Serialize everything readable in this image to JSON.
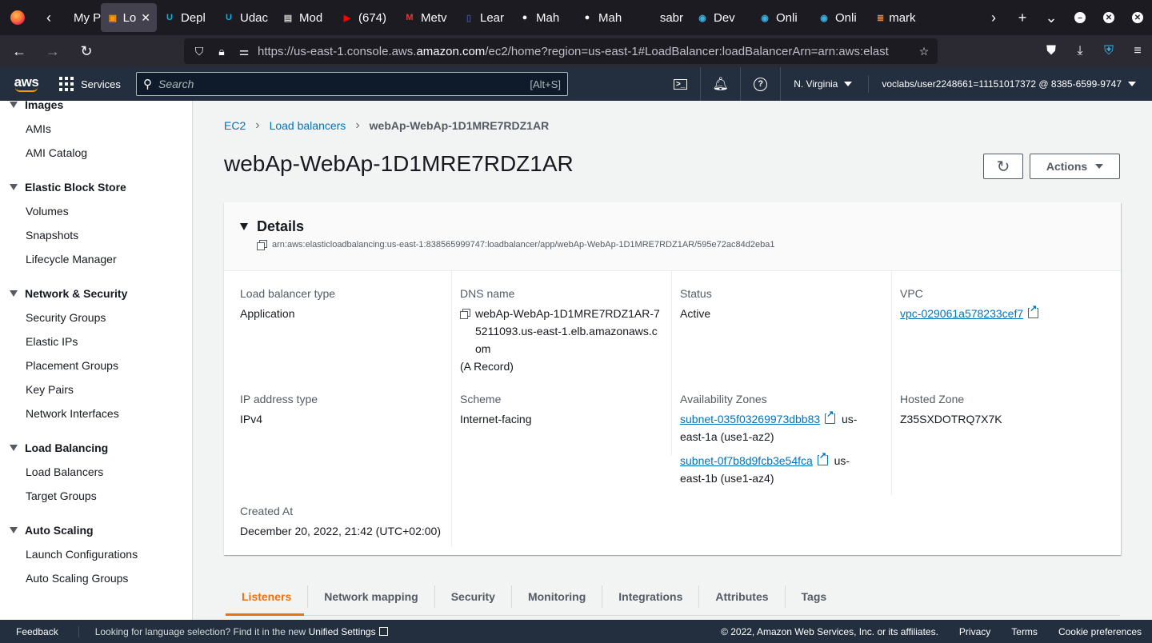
{
  "browser": {
    "tabs": [
      {
        "label": "My P",
        "icon": "page-icon",
        "color": "#fbfbfe"
      },
      {
        "label": "Lo",
        "icon": "aws-box-icon",
        "color": "#ff9900",
        "active": true
      },
      {
        "label": "Depl",
        "icon": "udacity-icon",
        "color": "#02b3e4"
      },
      {
        "label": "Udac",
        "icon": "udacity-icon",
        "color": "#02b3e4"
      },
      {
        "label": "Mod",
        "icon": "doc-icon",
        "color": "#cccccc"
      },
      {
        "label": "(674)",
        "icon": "youtube-icon",
        "color": "#ff0000"
      },
      {
        "label": "Metv",
        "icon": "m-icon",
        "color": "#e03a3a"
      },
      {
        "label": "Lear",
        "icon": "book-icon",
        "color": "#3d4f9f"
      },
      {
        "label": "Mah",
        "icon": "github-icon",
        "color": "#ffffff"
      },
      {
        "label": "Mah",
        "icon": "github-icon",
        "color": "#ffffff"
      },
      {
        "label": "sabr",
        "icon": "blank-icon",
        "color": "#888888"
      },
      {
        "label": "Dev",
        "icon": "eye-icon",
        "color": "#3ab0e0"
      },
      {
        "label": "Onli",
        "icon": "eye-icon",
        "color": "#3ab0e0"
      },
      {
        "label": "Onli",
        "icon": "eye-icon",
        "color": "#3ab0e0"
      },
      {
        "label": "mark",
        "icon": "stack-icon",
        "color": "#f48024"
      }
    ],
    "url_prefix": "https://us-east-1.console.aws.",
    "url_domain": "amazon.com",
    "url_rest": "/ec2/home?region=us-east-1#LoadBalancer:loadBalancerArn=arn:aws:elast"
  },
  "aws_header": {
    "logo": "aws",
    "services": "Services",
    "search_placeholder": "Search",
    "search_shortcut": "[Alt+S]",
    "region": "N. Virginia",
    "account": "voclabs/user2248661=11151017372 @ 8385-6599-9747"
  },
  "sidebar": {
    "sections": [
      {
        "title": "Images",
        "items": [
          "AMIs",
          "AMI Catalog"
        ]
      },
      {
        "title": "Elastic Block Store",
        "items": [
          "Volumes",
          "Snapshots",
          "Lifecycle Manager"
        ]
      },
      {
        "title": "Network & Security",
        "items": [
          "Security Groups",
          "Elastic IPs",
          "Placement Groups",
          "Key Pairs",
          "Network Interfaces"
        ]
      },
      {
        "title": "Load Balancing",
        "items": [
          "Load Balancers",
          "Target Groups"
        ]
      },
      {
        "title": "Auto Scaling",
        "items": [
          "Launch Configurations",
          "Auto Scaling Groups"
        ]
      }
    ]
  },
  "breadcrumb": {
    "items": [
      "EC2",
      "Load balancers"
    ],
    "current": "webAp-WebAp-1D1MRE7RDZ1AR"
  },
  "page": {
    "title": "webAp-WebAp-1D1MRE7RDZ1AR",
    "actions_label": "Actions"
  },
  "details": {
    "title": "Details",
    "arn": "arn:aws:elasticloadbalancing:us-east-1:838565999747:loadbalancer/app/webAp-WebAp-1D1MRE7RDZ1AR/595e72ac84d2eba1",
    "lb_type_label": "Load balancer type",
    "lb_type": "Application",
    "dns_label": "DNS name",
    "dns_line1": "webAp-WebAp-1D1MRE7RDZ1AR-7",
    "dns_line2": "5211093.us-east-1.elb.amazonaws.c",
    "dns_line3": "om",
    "dns_record": "(A Record)",
    "status_label": "Status",
    "status": "Active",
    "vpc_label": "VPC",
    "vpc": "vpc-029061a578233cef7",
    "ip_type_label": "IP address type",
    "ip_type": "IPv4",
    "scheme_label": "Scheme",
    "scheme": "Internet-facing",
    "az_label": "Availability Zones",
    "az1_subnet": "subnet-035f03269973dbb83",
    "az1_suffix": "us-",
    "az1_rest": "east-1a (use1-az2)",
    "az2_subnet": "subnet-0f7b8d9fcb3e54fca",
    "az2_suffix": "us-",
    "az2_rest": "east-1b (use1-az4)",
    "hosted_zone_label": "Hosted Zone",
    "hosted_zone": "Z35SXDOTRQ7X7K",
    "created_label": "Created At",
    "created": "December 20, 2022, 21:42 (UTC+02:00)"
  },
  "detail_tabs": [
    "Listeners",
    "Network mapping",
    "Security",
    "Monitoring",
    "Integrations",
    "Attributes",
    "Tags"
  ],
  "footer": {
    "feedback": "Feedback",
    "lang_text": "Looking for language selection? Find it in the new",
    "unified": "Unified Settings",
    "copyright": "© 2022, Amazon Web Services, Inc. or its affiliates.",
    "privacy": "Privacy",
    "terms": "Terms",
    "cookies": "Cookie preferences"
  },
  "colors": {
    "aws_nav": "#232f3e",
    "link": "#0073bb",
    "active_tab": "#ec7211"
  }
}
